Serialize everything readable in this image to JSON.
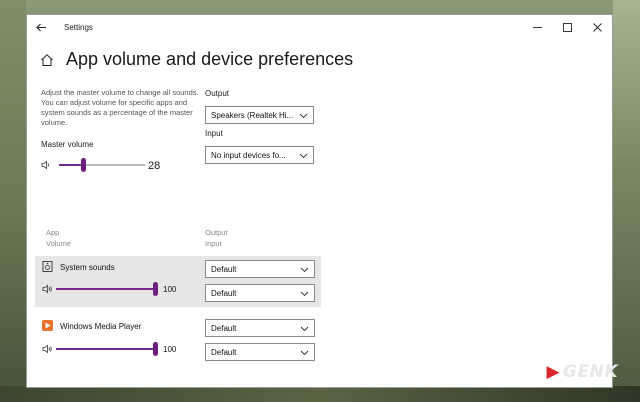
{
  "window": {
    "app_title": "Settings",
    "page_title": "App volume and device preferences"
  },
  "master": {
    "description": "Adjust the master volume to change all sounds. You can adjust volume for specific apps and system sounds as a percentage of the master volume.",
    "label": "Master volume",
    "value": "28",
    "level": 0.28
  },
  "output": {
    "label": "Output",
    "selected": "Speakers (Realtek Hi..."
  },
  "input": {
    "label": "Input",
    "selected": "No input devices fo..."
  },
  "columns": {
    "app": "App",
    "volume": "Volume",
    "output": "Output",
    "input": "Input"
  },
  "apps": [
    {
      "name": "System sounds",
      "value": "100",
      "level": 1.0,
      "output": "Default",
      "input": "Default",
      "icon": "speaker-box-icon"
    },
    {
      "name": "Windows Media Player",
      "value": "100",
      "level": 1.0,
      "output": "Default",
      "input": "Default",
      "icon": "media-player-icon"
    }
  ],
  "watermark": {
    "text": "GENK"
  },
  "colors": {
    "accent": "#6b1f80",
    "brand_red": "#d9272d"
  }
}
